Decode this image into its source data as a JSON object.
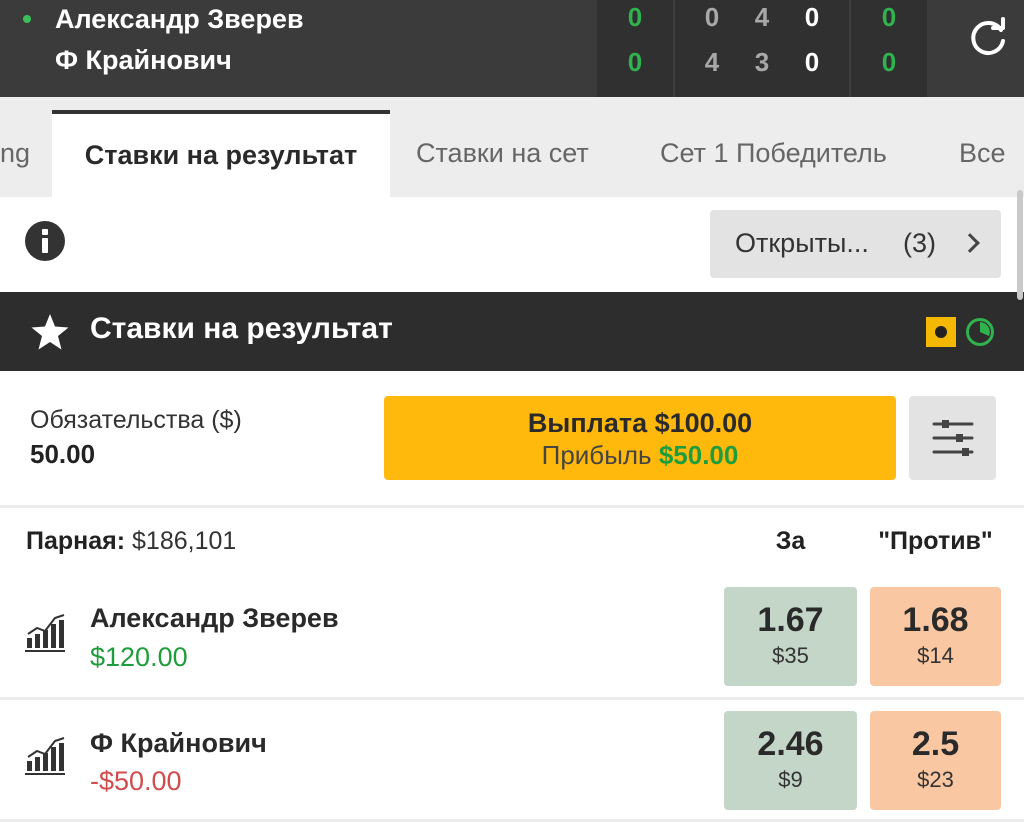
{
  "scoreboard": {
    "players": [
      "Александр Зверев",
      "Ф Крайнович"
    ],
    "player1_scores": [
      "0",
      "0",
      "4",
      "0",
      "0"
    ],
    "player2_scores": [
      "0",
      "4",
      "3",
      "0",
      "0"
    ]
  },
  "tabs": [
    {
      "label": "ng",
      "active": false
    },
    {
      "label": "Ставки на результат",
      "active": true
    },
    {
      "label": "Ставки на сет",
      "active": false
    },
    {
      "label": "Сет 1 Победитель",
      "active": false
    },
    {
      "label": "Все",
      "active": false
    }
  ],
  "open_bets": {
    "label": "Открыты...",
    "count": "(3)"
  },
  "market": {
    "title": "Ставки на результат",
    "liability_label": "Обязательства ($)",
    "liability_value": "50.00",
    "payout_label": "Выплата $100.00",
    "profit_label": "Прибыль",
    "profit_value": "$50.00"
  },
  "selection_header": {
    "matched_label": "Парная:",
    "matched_value": "$186,101",
    "back_label": "За",
    "lay_label": "\"Против\""
  },
  "runners": [
    {
      "name": "Александр Зверев",
      "pl": "$120.00",
      "pl_sign": "positive",
      "back_price": "1.67",
      "back_size": "$35",
      "lay_price": "1.68",
      "lay_size": "$14"
    },
    {
      "name": "Ф Крайнович",
      "pl": "-$50.00",
      "pl_sign": "negative",
      "back_price": "2.46",
      "back_size": "$9",
      "lay_price": "2.5",
      "lay_size": "$23"
    }
  ],
  "colors": {
    "dark_header": "#2d2d2d",
    "accent_yellow": "#ffb80c",
    "back_bg": "#c4d6c8",
    "lay_bg": "#f9c8a3",
    "positive": "#1f9d3c",
    "negative": "#d14c4c"
  },
  "icons": [
    "serve-indicator-icon",
    "refresh-icon",
    "info-icon",
    "chevron-right-icon",
    "star-icon",
    "in-play-icon",
    "timer-icon",
    "filter-sliders-icon",
    "market-chart-icon"
  ]
}
